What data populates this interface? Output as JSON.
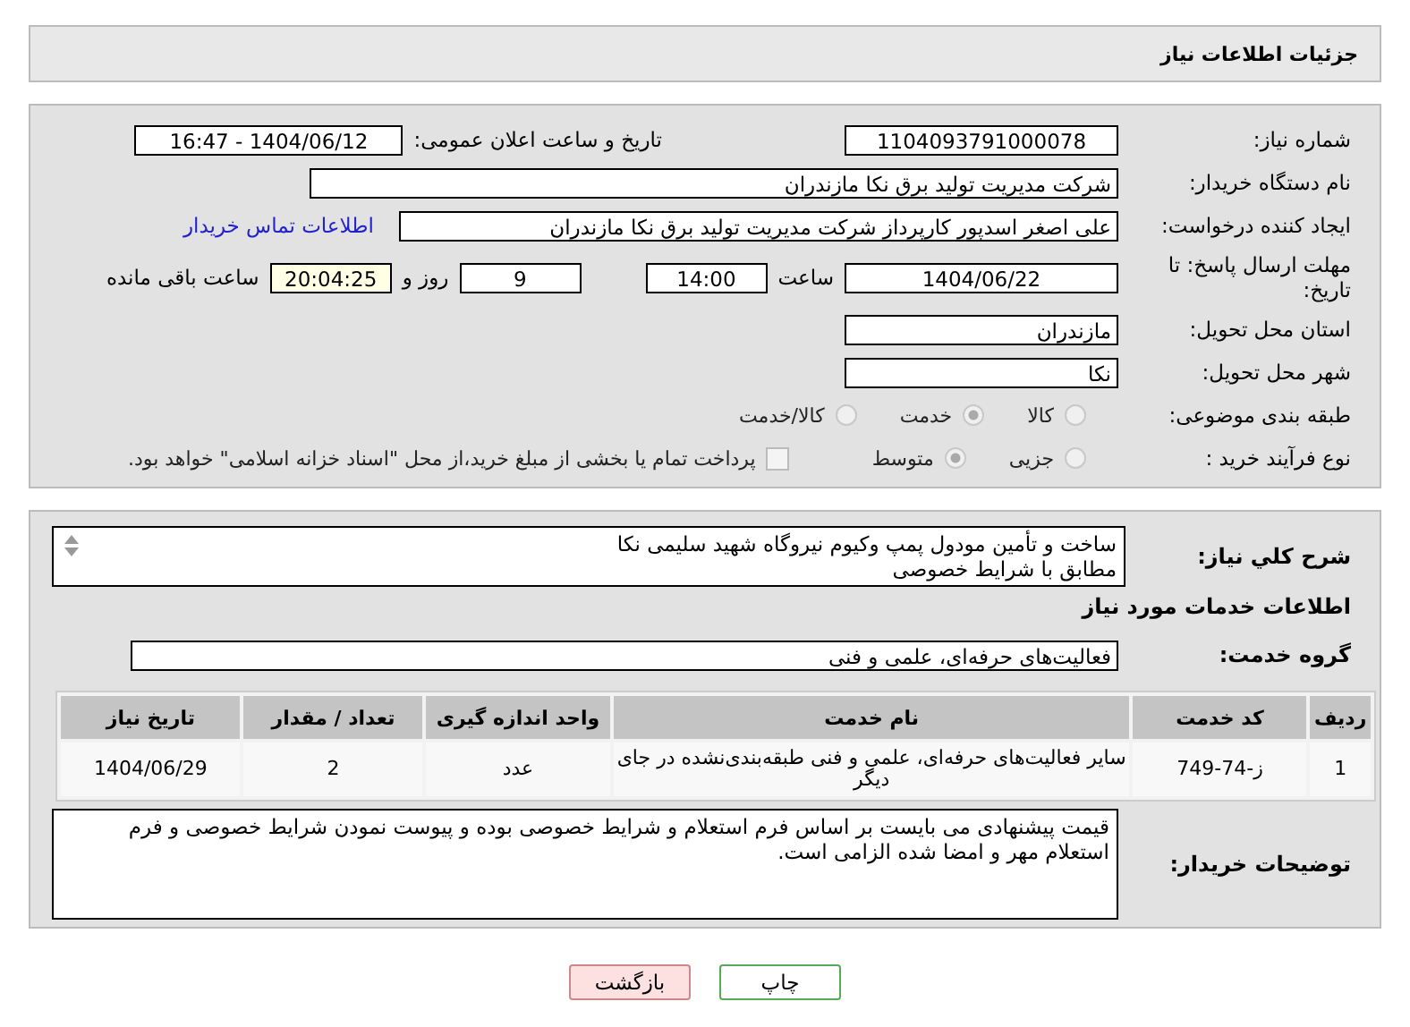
{
  "header": {
    "title": "جزئیات اطلاعات نیاز"
  },
  "need_number": {
    "label": "شماره نیاز:",
    "value": "1104093791000078"
  },
  "announcement": {
    "label": "تاریخ و ساعت اعلان عمومی:",
    "value": "1404/06/12 - 16:47"
  },
  "buyer_org": {
    "label": "نام دستگاه خریدار:",
    "value": "شرکت مدیریت تولید برق نکا  مازندران"
  },
  "creator": {
    "label": "ایجاد کننده درخواست:",
    "value": "علی اصغر اسدپور کارپرداز شرکت مدیریت تولید برق نکا  مازندران",
    "link": "اطلاعات تماس خریدار"
  },
  "deadline": {
    "label": "مهلت ارسال پاسخ: تا تاریخ:",
    "date": "1404/06/22",
    "time_label": "ساعت",
    "time": "14:00",
    "days": "9",
    "days_label": "روز و",
    "remaining": "20:04:25",
    "remaining_label": "ساعت باقی مانده"
  },
  "province": {
    "label": "استان محل تحویل:",
    "value": "مازندران"
  },
  "city": {
    "label": "شهر محل تحویل:",
    "value": "نکا"
  },
  "category": {
    "label": "طبقه بندی موضوعی:",
    "options": [
      {
        "label": "کالا",
        "selected": false
      },
      {
        "label": "خدمت",
        "selected": true
      },
      {
        "label": "کالا/خدمت",
        "selected": false
      }
    ]
  },
  "purchase_type": {
    "label": "نوع فرآیند خرید :",
    "options": [
      {
        "label": "جزیی",
        "selected": false
      },
      {
        "label": "متوسط",
        "selected": true
      }
    ],
    "payment": {
      "label": "پرداخت تمام یا بخشی از مبلغ خرید،از محل \"اسناد خزانه اسلامی\" خواهد بود.",
      "checked": false
    }
  },
  "description": {
    "label": "شرح کلي نياز:",
    "lines": [
      "ساخت  و تأمین مودول پمپ وکیوم نیروگاه شهید سلیمی نکا",
      "مطابق با شرایط خصوصی"
    ]
  },
  "services_title": "اطلاعات خدمات مورد نیاز",
  "service_group": {
    "label": "گروه خدمت:",
    "value": "فعالیت‌های حرفه‌ای، علمی و فنی"
  },
  "table": {
    "columns": [
      "ردیف",
      "کد خدمت",
      "نام خدمت",
      "واحد اندازه گیری",
      "تعداد / مقدار",
      "تاریخ نیاز"
    ],
    "rows": [
      [
        "1",
        "ز-74-749",
        "سایر فعالیت‌های حرفه‌ای، علمی و فنی طبقه‌بندی‌نشده در جای دیگر",
        "عدد",
        "2",
        "1404/06/29"
      ]
    ]
  },
  "buyer_notes": {
    "label": "توضیحات خریدار:",
    "value": "قیمت پیشنهادی می بایست بر اساس فرم استعلام و شرایط خصوصی بوده و پیوست نمودن شرایط خصوصی و فرم استعلام مهر و امضا شده الزامی است."
  },
  "buttons": [
    {
      "label": "چاپ",
      "kind": "print"
    },
    {
      "label": "بازگشت",
      "kind": "back"
    }
  ]
}
